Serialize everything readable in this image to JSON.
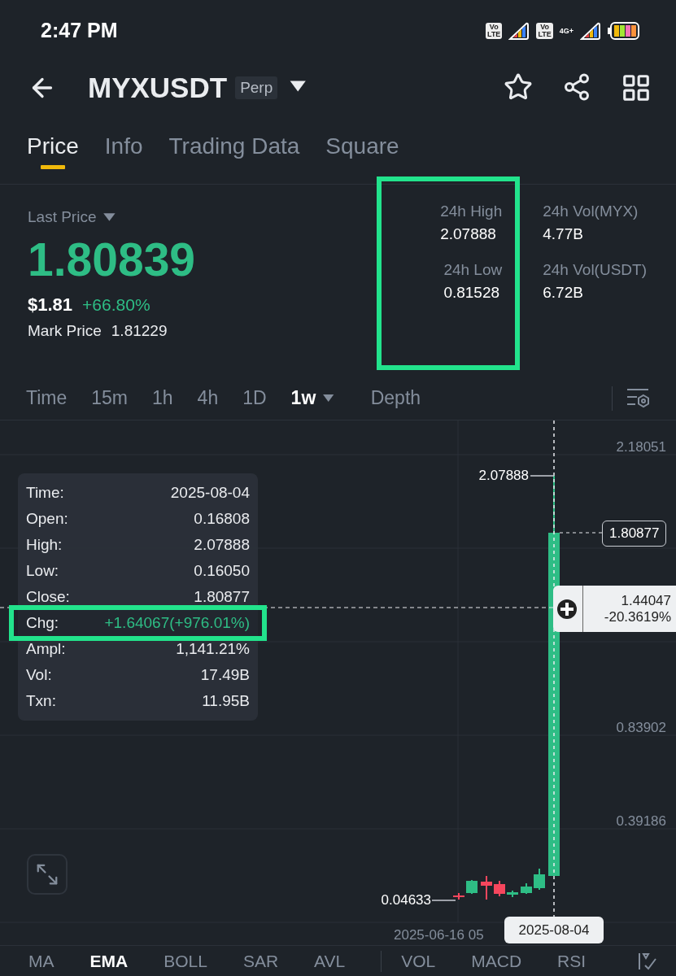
{
  "status_bar": {
    "time": "2:47 PM",
    "sims": [
      {
        "badge_top": "Vo",
        "badge_bottom": "LTE"
      },
      {
        "badge_top": "Vo",
        "badge_bottom": "LTE",
        "network": "4G+"
      }
    ]
  },
  "header": {
    "symbol": "MYXUSDT",
    "contract": "Perp"
  },
  "tabs": [
    {
      "label": "Price",
      "selected": true
    },
    {
      "label": "Info",
      "selected": false
    },
    {
      "label": "Trading Data",
      "selected": false
    },
    {
      "label": "Square",
      "selected": false
    }
  ],
  "price": {
    "last_price_label": "Last Price",
    "last_price": "1.80839",
    "usd": "$1.81",
    "change": "+66.80%",
    "mark_label": "Mark Price",
    "mark_value": "1.81229"
  },
  "stats_columns": [
    {
      "highlighted": true,
      "items": [
        {
          "label": "24h High",
          "value": "2.07888"
        },
        {
          "label": "24h Low",
          "value": "0.81528"
        }
      ]
    },
    {
      "highlighted": false,
      "items": [
        {
          "label": "24h Vol(MYX)",
          "value": "4.77B"
        },
        {
          "label": "24h Vol(USDT)",
          "value": "6.72B"
        }
      ]
    }
  ],
  "intervals": [
    {
      "label": "Time",
      "selected": false
    },
    {
      "label": "15m",
      "selected": false
    },
    {
      "label": "1h",
      "selected": false
    },
    {
      "label": "4h",
      "selected": false
    },
    {
      "label": "1D",
      "selected": false
    },
    {
      "label": "1w",
      "selected": true,
      "dropdown": true
    },
    {
      "label": "Depth",
      "selected": false
    }
  ],
  "chart": {
    "y_labels": [
      "2.18051",
      "0.83902",
      "0.39186"
    ],
    "high_label": "2.07888",
    "low_label": "0.04633",
    "close_label": "1.80877",
    "crosshair": {
      "price": "1.44047",
      "change": "-20.3619%",
      "date": "2025-08-04"
    },
    "x_label": "2025-06-16 05",
    "tooltip": [
      {
        "label": "Time:",
        "value": "2025-08-04",
        "kind": "plain",
        "highlighted": false
      },
      {
        "label": "Open:",
        "value": "0.16808",
        "kind": "plain",
        "highlighted": false
      },
      {
        "label": "High:",
        "value": "2.07888",
        "kind": "plain",
        "highlighted": false
      },
      {
        "label": "Low:",
        "value": "0.16050",
        "kind": "plain",
        "highlighted": false
      },
      {
        "label": "Close:",
        "value": "1.80877",
        "kind": "plain",
        "highlighted": false
      },
      {
        "label": "Chg:",
        "value": "+1.64067(+976.01%)",
        "kind": "up",
        "highlighted": true
      },
      {
        "label": "Ampl:",
        "value": "1,141.21%",
        "kind": "plain",
        "highlighted": false
      },
      {
        "label": "Vol:",
        "value": "17.49B",
        "kind": "plain",
        "highlighted": false
      },
      {
        "label": "Txn:",
        "value": "11.95B",
        "kind": "plain",
        "highlighted": false
      }
    ]
  },
  "indicators": {
    "main": [
      {
        "label": "MA",
        "selected": false
      },
      {
        "label": "EMA",
        "selected": true
      },
      {
        "label": "BOLL",
        "selected": false
      },
      {
        "label": "SAR",
        "selected": false
      },
      {
        "label": "AVL",
        "selected": false
      }
    ],
    "sub": [
      {
        "label": "VOL",
        "selected": false
      },
      {
        "label": "MACD",
        "selected": false
      },
      {
        "label": "RSI",
        "selected": false
      }
    ]
  }
}
